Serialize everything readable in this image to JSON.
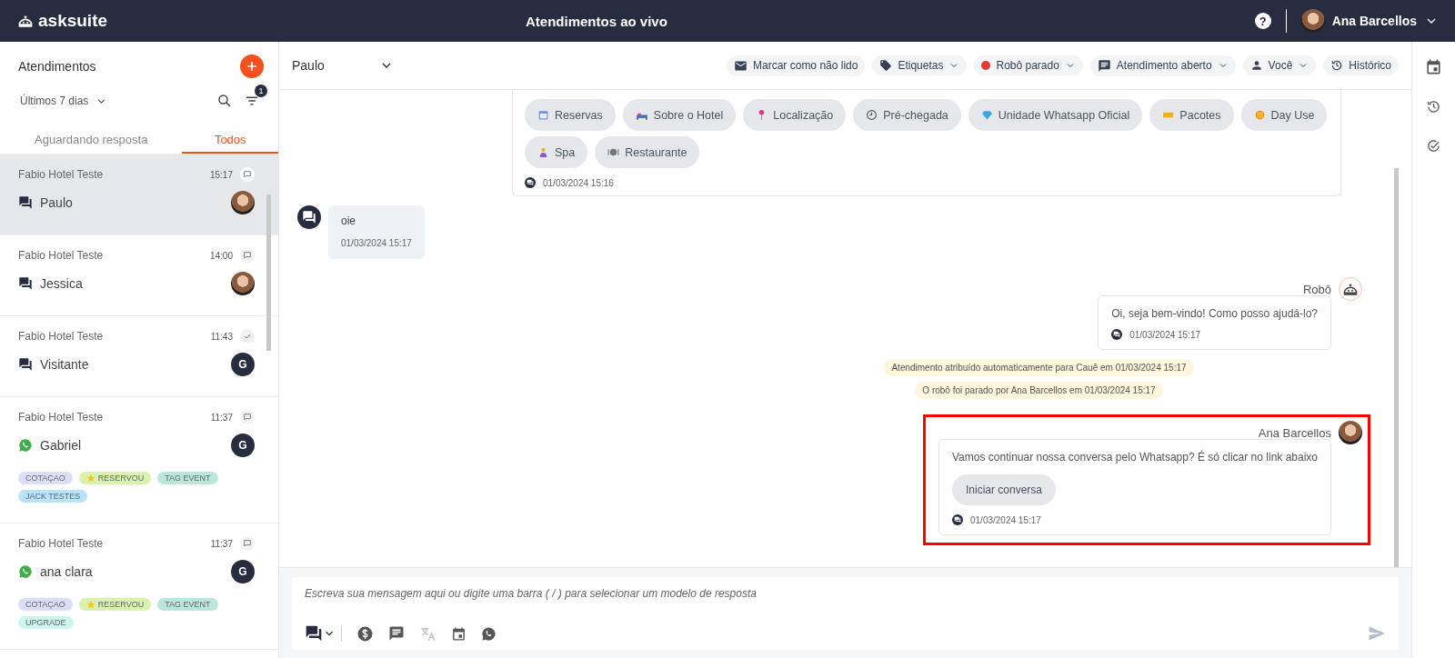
{
  "topbar": {
    "logo": "asksuite",
    "title": "Atendimentos ao vivo",
    "help": "?",
    "user": {
      "name": "Ana Barcellos"
    }
  },
  "sidebar": {
    "title": "Atendimentos",
    "period": "Últimos 7 dias",
    "filter_count": "1",
    "tabs": [
      {
        "label": "Aguardando resposta",
        "selected": false
      },
      {
        "label": "Todos",
        "selected": true
      }
    ],
    "conversations": [
      {
        "hotel": "Fabio Hotel Teste",
        "time": "15:17",
        "resolved": false,
        "kind": "chat",
        "name": "Paulo",
        "avatar": {
          "kind": "photo"
        },
        "selected": true
      },
      {
        "hotel": "Fabio Hotel Teste",
        "time": "14:00",
        "resolved": false,
        "kind": "chat",
        "name": "Jessica",
        "avatar": {
          "kind": "photo"
        },
        "selected": false
      },
      {
        "hotel": "Fabio Hotel Teste",
        "time": "11:43",
        "resolved": true,
        "kind": "chat",
        "name": "Visitante",
        "avatar": {
          "kind": "letter",
          "letter": "G"
        },
        "selected": false
      },
      {
        "hotel": "Fabio Hotel Teste",
        "time": "11:37",
        "resolved": false,
        "kind": "whatsapp",
        "name": "Gabriel",
        "avatar": {
          "kind": "letter",
          "letter": "G"
        },
        "selected": false,
        "tags": [
          {
            "label": "COTAÇAO",
            "color": "#dcdef7",
            "star": false
          },
          {
            "label": "RESERVOU",
            "color": "#d9f2ae",
            "star": true
          },
          {
            "label": "TAG EVENT",
            "color": "#b9e8da",
            "star": false
          },
          {
            "label": "JACK TESTES",
            "color": "#b8e4fb",
            "star": false
          }
        ]
      },
      {
        "hotel": "Fabio Hotel Teste",
        "time": "11:37",
        "resolved": false,
        "kind": "whatsapp",
        "name": "ana clara",
        "avatar": {
          "kind": "letter",
          "letter": "G"
        },
        "selected": false,
        "tags": [
          {
            "label": "COTAÇAO",
            "color": "#dcdef7",
            "star": false
          },
          {
            "label": "RESERVOU",
            "color": "#d9f2ae",
            "star": true
          },
          {
            "label": "TAG EVENT",
            "color": "#b9e8da",
            "star": false
          },
          {
            "label": "UPGRADE",
            "color": "#cbf6ef",
            "star": false
          }
        ]
      }
    ]
  },
  "chat": {
    "contact": "Paulo",
    "actions": [
      {
        "label": "Marcar como não lido",
        "dropdown": false
      },
      {
        "label": "Etiquetas",
        "dropdown": true
      },
      {
        "label": "Robô parado",
        "dropdown": true
      },
      {
        "label": "Atendimento aberto",
        "dropdown": true
      },
      {
        "label": "Você",
        "dropdown": true
      },
      {
        "label": "Histórico",
        "dropdown": false
      }
    ],
    "messages": [
      {
        "kind": "quick_replies",
        "time": "01/03/2024 15:16",
        "chips": [
          "Reservas",
          "Sobre o Hotel",
          "Localização",
          "Pré-chegada",
          "Unidade Whatsapp Oficial",
          "Pacotes",
          "Day Use",
          "Spa",
          "Restaurante"
        ]
      },
      {
        "kind": "incoming",
        "text": "oie",
        "time": "01/03/2024 15:17"
      },
      {
        "kind": "outgoing",
        "sender": "Robô",
        "avatar": {
          "kind": "robot"
        },
        "text": "Oi, seja bem-vindo! Como posso ajudá-lo?",
        "time": "01/03/2024 15:17",
        "highlighted": false
      },
      {
        "kind": "system",
        "text": "Atendimento atribuído automaticamente para Cauê em 01/03/2024 15:17"
      },
      {
        "kind": "system",
        "text": "O robô foi parado por Ana Barcellos em 01/03/2024 15:17"
      },
      {
        "kind": "outgoing",
        "sender": "Ana Barcellos",
        "avatar": {
          "kind": "photo"
        },
        "text": "Vamos continuar nossa conversa pelo Whatsapp? É só clicar no link abaixo",
        "button": "Iniciar conversa",
        "time": "01/03/2024 15:17",
        "highlighted": true
      }
    ]
  },
  "composer": {
    "placeholder": "Escreva sua mensagem aqui ou digite uma barra ( / ) para selecionar um modelo de resposta"
  }
}
